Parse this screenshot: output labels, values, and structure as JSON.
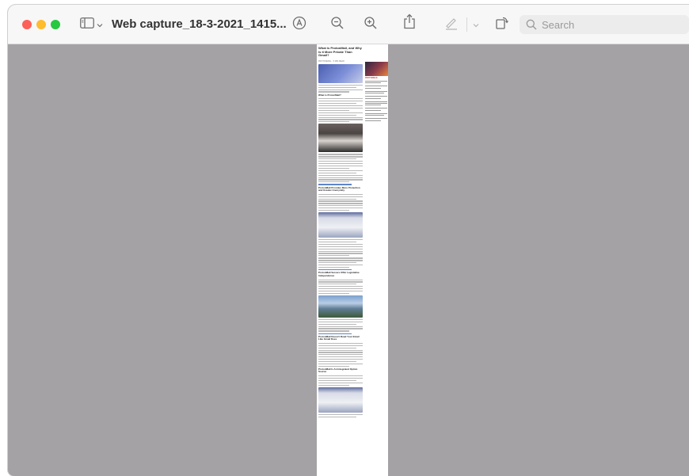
{
  "window": {
    "title": "Web capture_18-3-2021_1415...",
    "search_placeholder": "Search"
  },
  "toolbar": {
    "icons": [
      "sidebar-toggle-icon",
      "chevron-down-icon",
      "markup-icon",
      "zoom-out-icon",
      "zoom-in-icon",
      "share-icon",
      "pen-icon",
      "chevron-down-icon",
      "rotate-icon",
      "search-icon"
    ]
  },
  "document": {
    "title": "What is ProtonMail, and Why is it More Private Than Gmail?",
    "byline": "PROTONMAIL · 5 MIN READ",
    "headings": [
      "What is ProtonMail?",
      "ProtonMail Provides More Protection and Greater Anonymity",
      "ProtonMail Servers Offer Legislative Independence",
      "ProtonMail Doesn't Read Your Email Like Gmail Does",
      "ProtonMail Is An Integrated Option Source"
    ],
    "sidebar_label": "PROTONMAIL"
  },
  "colors": {
    "window_bg": "#a5a2a5",
    "toolbar_bg": "#f7f7f7",
    "close": "#fe5f57",
    "minimize": "#febc2e",
    "maximize": "#28c840",
    "link": "#5d86c7"
  }
}
